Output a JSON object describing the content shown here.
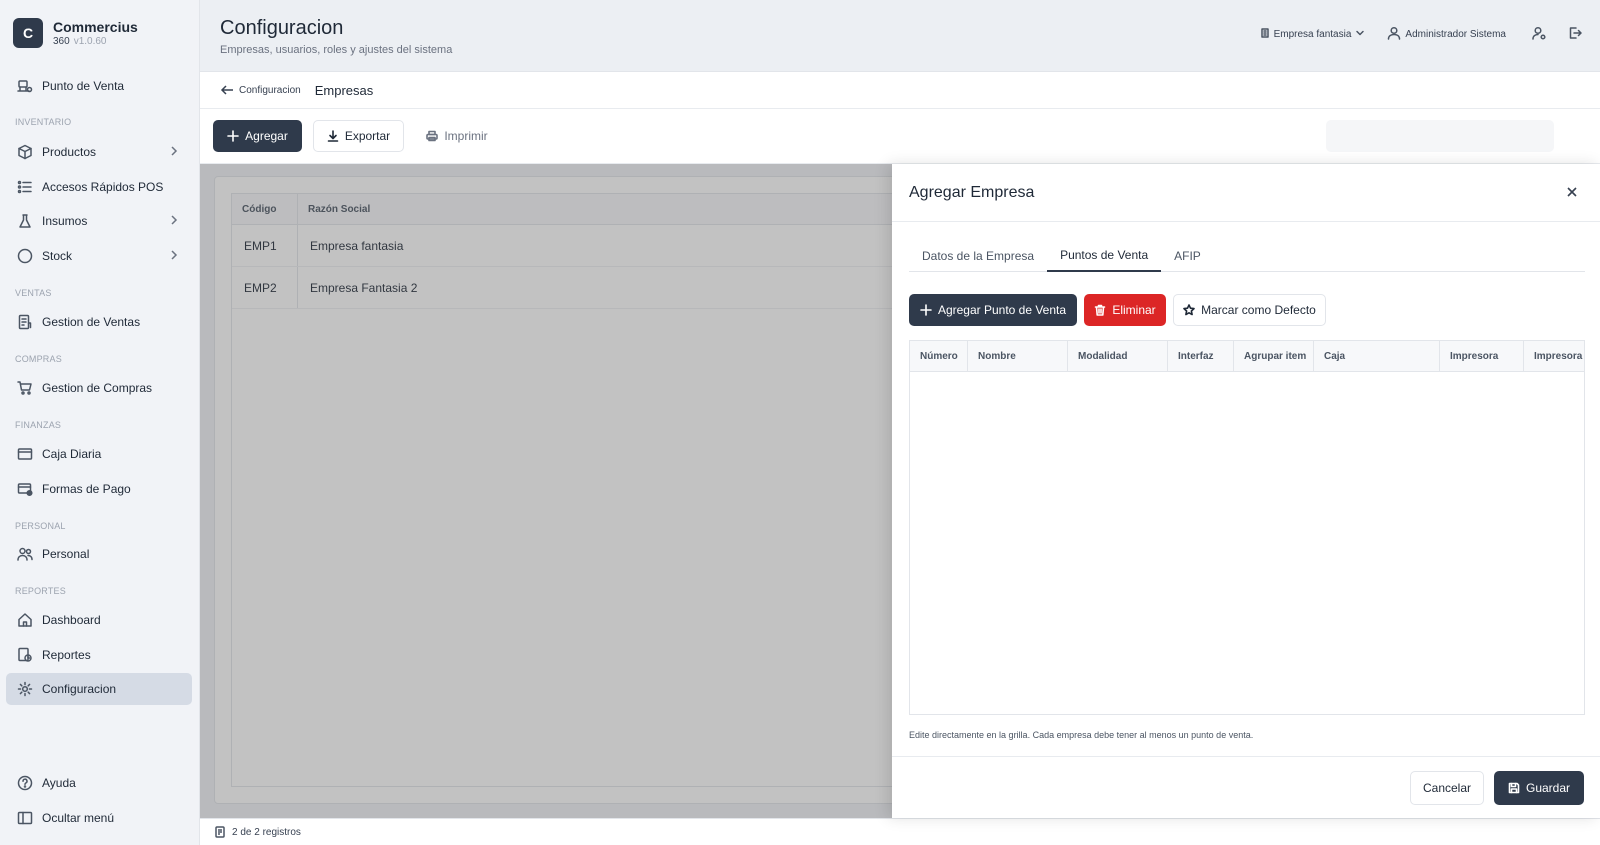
{
  "brand": {
    "logo_letter": "C",
    "name": "Commercius",
    "product": "360",
    "version": "v1.0.60"
  },
  "sidebar": {
    "items": [
      {
        "label": "Punto de Venta"
      },
      {
        "section": "INVENTARIO"
      },
      {
        "label": "Productos"
      },
      {
        "label": "Accesos Rápidos POS"
      },
      {
        "label": "Insumos"
      },
      {
        "label": "Stock"
      },
      {
        "section": "VENTAS"
      },
      {
        "label": "Gestion de Ventas"
      },
      {
        "section": "COMPRAS"
      },
      {
        "label": "Gestion de Compras"
      },
      {
        "section": "FINANZAS"
      },
      {
        "label": "Caja Diaria"
      },
      {
        "label": "Formas de Pago"
      },
      {
        "section": "PERSONAL"
      },
      {
        "label": "Personal"
      },
      {
        "section": "REPORTES"
      },
      {
        "label": "Dashboard"
      },
      {
        "label": "Reportes"
      },
      {
        "label": "Configuracion",
        "active": true
      }
    ],
    "bottom": [
      {
        "label": "Ayuda"
      },
      {
        "label": "Ocultar menú"
      }
    ]
  },
  "header": {
    "title": "Configuracion",
    "subtitle": "Empresas, usuarios, roles y ajustes del sistema",
    "company": "Empresa fantasia",
    "user": "Administrador Sistema"
  },
  "breadcrumb": {
    "back": "Configuracion",
    "current": "Empresas"
  },
  "toolbar": {
    "add": "Agregar",
    "export": "Exportar",
    "print": "Imprimir",
    "search_value": ""
  },
  "grid": {
    "columns": [
      "Código",
      "Razón Social"
    ],
    "rows": [
      {
        "code": "EMP1",
        "name": "Empresa fantasia"
      },
      {
        "code": "EMP2",
        "name": "Empresa Fantasia 2"
      }
    ]
  },
  "footer": {
    "count": "2 de 2 registros"
  },
  "drawer": {
    "title": "Agregar Empresa",
    "tabs": [
      "Datos de la Empresa",
      "Puntos de Venta",
      "AFIP"
    ],
    "active_tab": "Puntos de Venta",
    "actions": {
      "add": "Agregar Punto de Venta",
      "delete": "Eliminar",
      "default": "Marcar como Defecto"
    },
    "columns": [
      "Número",
      "Nombre",
      "Modalidad",
      "Interfaz",
      "Agrupar item",
      "Caja",
      "Impresora",
      "Impresora V"
    ],
    "hint": "Edite directamente en la grilla. Cada empresa debe tener al menos un punto de venta.",
    "cancel": "Cancelar",
    "save": "Guardar"
  },
  "colors": {
    "primary": "#2f3a4b",
    "danger": "#dc2626",
    "sidebar_bg": "#f1f3f7",
    "active_item": "#d5dbe5"
  }
}
